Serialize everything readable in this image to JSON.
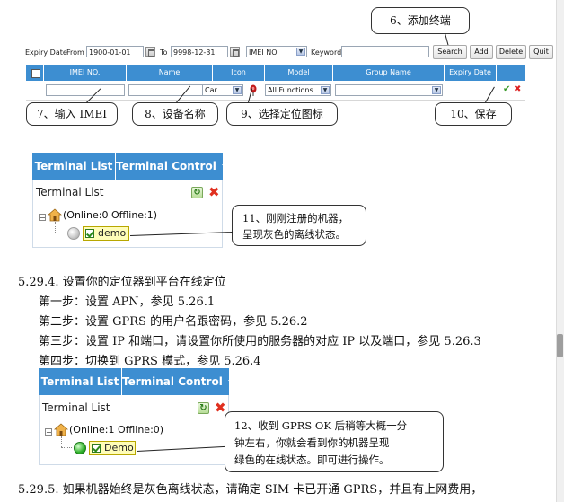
{
  "filter": {
    "expiry_label": "Expiry Date",
    "from_label": "From",
    "from_value": "1900-01-01",
    "to_label": "To",
    "to_value": "9998-12-31",
    "field_select": "IMEI NO.",
    "keyword_label": "Keyword:",
    "keyword_value": "",
    "search_btn": "Search",
    "add_btn": "Add",
    "delete_btn": "Delete",
    "quit_btn": "Quit"
  },
  "table": {
    "columns": [
      "IMEI NO.",
      "Name",
      "Icon",
      "Model",
      "Group Name",
      "Expiry Date"
    ],
    "row": {
      "imei": "",
      "name": "",
      "icon": "Car",
      "model": "All Functions",
      "group": ""
    }
  },
  "callouts": {
    "add": "6、添加终端",
    "imei": "7、输入 IMEI",
    "name": "8、设备名称",
    "icon": "9、选择定位图标",
    "save": "10、保存",
    "offline_line1": "11、刚刚注册的机器，",
    "offline_line2": "呈现灰色的离线状态。",
    "online_line1": "12、收到 GPRS OK 后稍等大概一分",
    "online_line2": "钟左右，你就会看到你的机器呈现",
    "online_line3": "绿色的在线状态。即可进行操作。"
  },
  "terminal1": {
    "tab_list": "Terminal List",
    "tab_control": "Terminal Control",
    "panel_title": "Terminal List",
    "group_status": "(Online:0   Offline:1)",
    "device": "demo"
  },
  "terminal2": {
    "tab_list": "Terminal List",
    "tab_control": "Terminal Control",
    "panel_title": "Terminal List",
    "group_status": "(Online:1   Offline:0)",
    "device": "Demo"
  },
  "doc": {
    "heading": "5.29.4. 设置你的定位器到平台在线定位",
    "step1": "第一步：设置 APN，参见 5.26.1",
    "step2": "第二步：设置 GPRS 的用户名跟密码，参见 5.26.2",
    "step3": "第三步：设置 IP 和端口，请设置你所使用的服务器的对应 IP 以及端口，参见 5.26.3",
    "step4": "第四步：切换到 GPRS 模式，参见 5.26.4",
    "footer": "5.29.5. 如果机器始终是灰色离线状态，请确定 SIM 卡已开通 GPRS，并且有上网费用，"
  },
  "colors": {
    "header_blue": "#3d8ed1",
    "offline_gray": "#c8c8c8",
    "online_green": "#2fb02a",
    "save_green": "#3a9a2a",
    "cancel_red": "#dd2222"
  }
}
